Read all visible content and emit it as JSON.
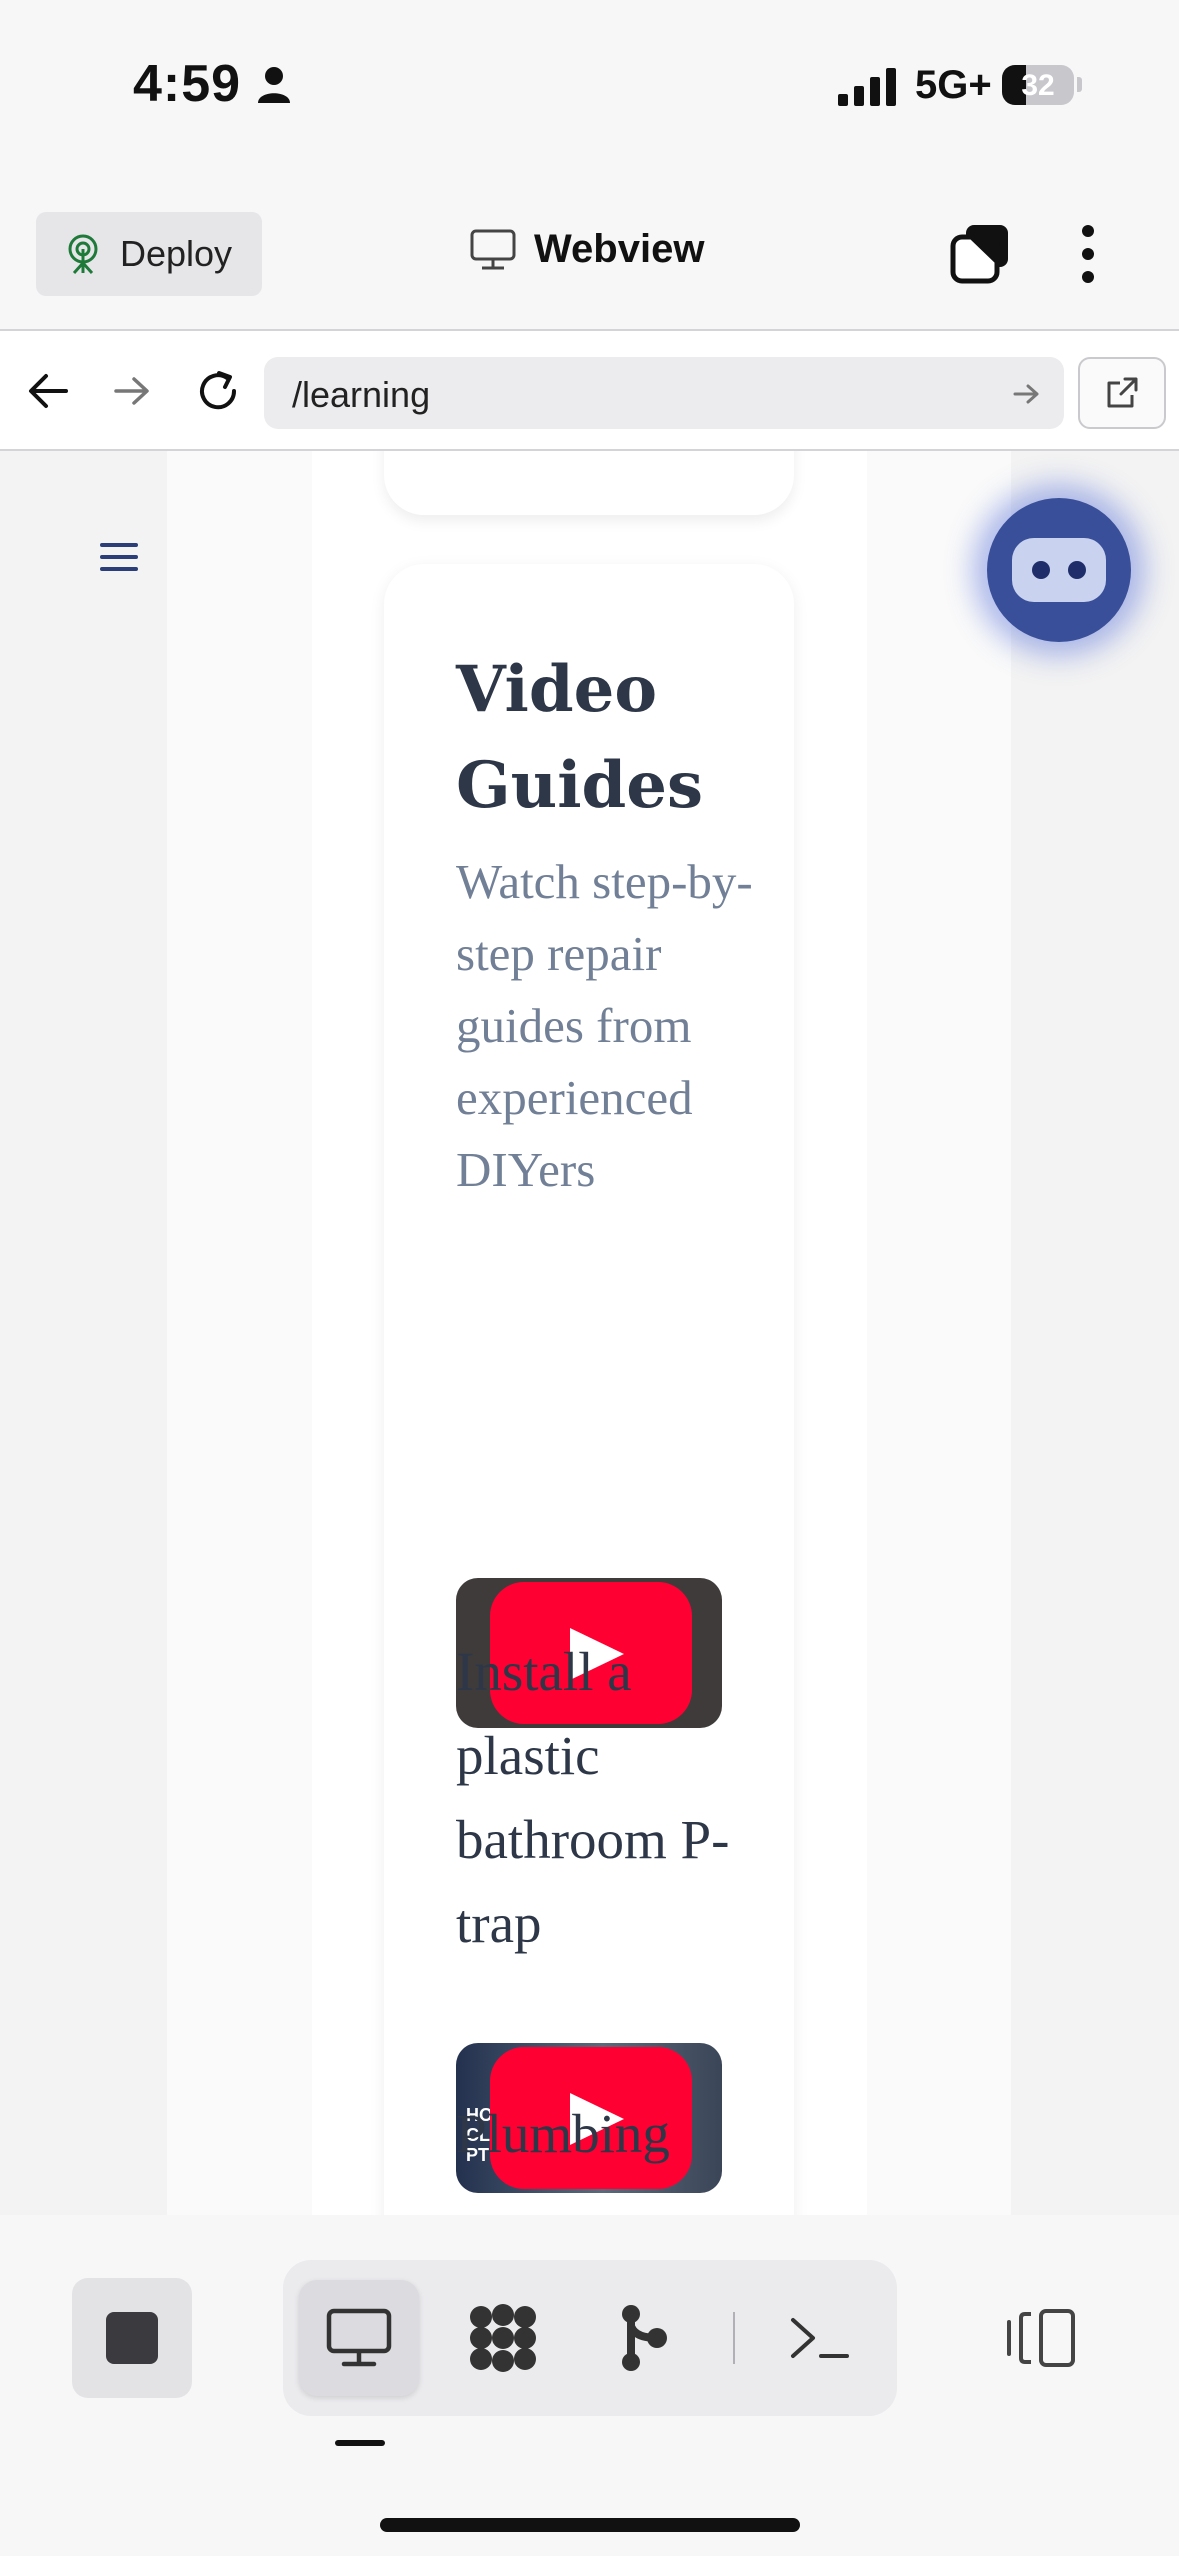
{
  "status_bar": {
    "time": "4:59",
    "network": "5G+",
    "battery": "32"
  },
  "header": {
    "deploy_label": "Deploy",
    "title": "Webview"
  },
  "url_bar": {
    "url": "/learning"
  },
  "card": {
    "title": "Video Guides",
    "subtitle": "Watch step-by-step repair guides from experienced DIYers",
    "videos": [
      {
        "title": "Install a plastic bathroom P-trap",
        "thumb_text": ""
      },
      {
        "title": "Plumbing",
        "thumb_text": "HO CL PT"
      }
    ]
  },
  "colors": {
    "accent_bot": "#3a4f9a",
    "youtube_red": "#ff0033",
    "heading": "#2d3748",
    "muted": "#718096"
  },
  "icons": {
    "header": [
      "deploy-icon",
      "monitor-icon",
      "tabs-icon",
      "more-vertical-icon"
    ],
    "toolbar": [
      "stop-icon",
      "monitor-icon",
      "packages-icon",
      "git-icon",
      "terminal-icon",
      "layout-icon"
    ]
  }
}
